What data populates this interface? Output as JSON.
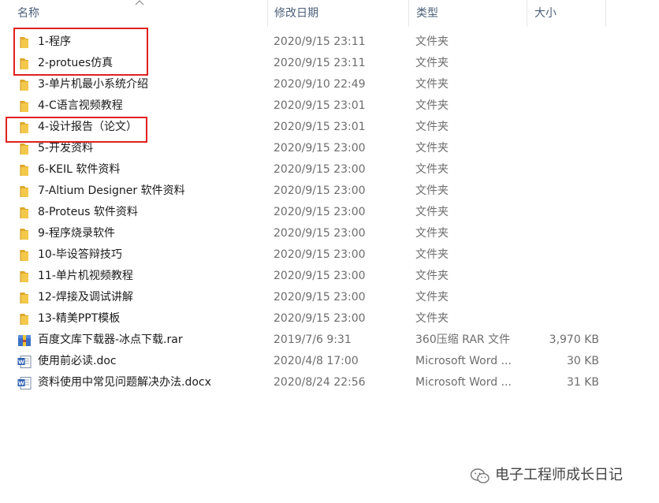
{
  "columns": {
    "name": "名称",
    "date": "修改日期",
    "type": "类型",
    "size": "大小"
  },
  "files": [
    {
      "name": "1-程序",
      "date": "2020/9/15 23:11",
      "type": "文件夹",
      "size": "",
      "icon": "folder-icon"
    },
    {
      "name": "2-protues仿真",
      "date": "2020/9/15 23:11",
      "type": "文件夹",
      "size": "",
      "icon": "folder-icon"
    },
    {
      "name": "3-单片机最小系统介绍",
      "date": "2020/9/10 22:49",
      "type": "文件夹",
      "size": "",
      "icon": "folder-icon"
    },
    {
      "name": "4-C语言视频教程",
      "date": "2020/9/15 23:01",
      "type": "文件夹",
      "size": "",
      "icon": "folder-icon"
    },
    {
      "name": "4-设计报告（论文）",
      "date": "2020/9/15 23:01",
      "type": "文件夹",
      "size": "",
      "icon": "folder-icon"
    },
    {
      "name": "5-开发资料",
      "date": "2020/9/15 23:00",
      "type": "文件夹",
      "size": "",
      "icon": "folder-icon"
    },
    {
      "name": "6-KEIL 软件资料",
      "date": "2020/9/15 23:00",
      "type": "文件夹",
      "size": "",
      "icon": "folder-icon"
    },
    {
      "name": "7-Altium Designer 软件资料",
      "date": "2020/9/15 23:00",
      "type": "文件夹",
      "size": "",
      "icon": "folder-icon"
    },
    {
      "name": "8-Proteus 软件资料",
      "date": "2020/9/15 23:00",
      "type": "文件夹",
      "size": "",
      "icon": "folder-icon"
    },
    {
      "name": "9-程序烧录软件",
      "date": "2020/9/15 23:00",
      "type": "文件夹",
      "size": "",
      "icon": "folder-icon"
    },
    {
      "name": "10-毕设答辩技巧",
      "date": "2020/9/15 23:00",
      "type": "文件夹",
      "size": "",
      "icon": "folder-icon"
    },
    {
      "name": "11-单片机视频教程",
      "date": "2020/9/15 23:00",
      "type": "文件夹",
      "size": "",
      "icon": "folder-icon"
    },
    {
      "name": "12-焊接及调试讲解",
      "date": "2020/9/15 23:00",
      "type": "文件夹",
      "size": "",
      "icon": "folder-icon"
    },
    {
      "name": "13-精美PPT模板",
      "date": "2020/9/15 23:00",
      "type": "文件夹",
      "size": "",
      "icon": "folder-icon"
    },
    {
      "name": "百度文库下载器-冰点下载.rar",
      "date": "2019/7/6 9:31",
      "type": "360压缩 RAR 文件",
      "size": "3,970 KB",
      "icon": "archive-icon"
    },
    {
      "name": "使用前必读.doc",
      "date": "2020/4/8 17:00",
      "type": "Microsoft Word ...",
      "size": "30 KB",
      "icon": "word-doc-icon"
    },
    {
      "name": "资料使用中常见问题解决办法.docx",
      "date": "2020/8/24 22:56",
      "type": "Microsoft Word ...",
      "size": "31 KB",
      "icon": "word-doc-icon"
    }
  ],
  "watermark": {
    "text": "电子工程师成长日记"
  },
  "colors": {
    "folder": "#f4c84a",
    "highlight": "#e02020",
    "header_text": "#4c607a"
  }
}
